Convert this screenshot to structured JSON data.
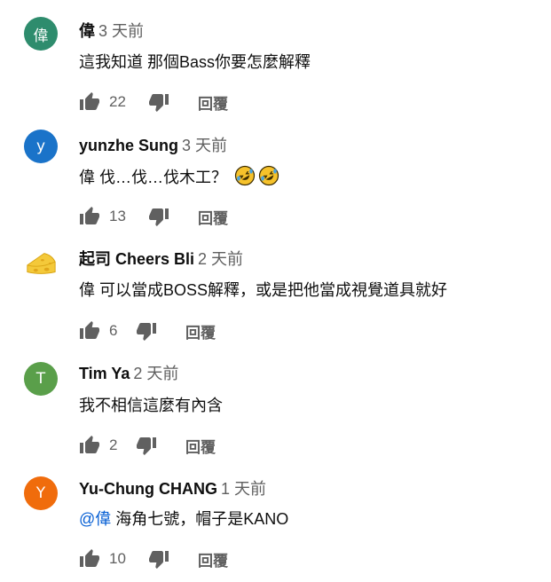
{
  "comments": [
    {
      "avatar_char": "偉",
      "avatar_color": "#2e8c6d",
      "author": "偉",
      "time": "3 天前",
      "text": "這我知道 那個Bass你要怎麼解釋",
      "likes": "22",
      "reply_label": "回覆"
    },
    {
      "avatar_char": "y",
      "avatar_color": "#1a73c9",
      "author": "yunzhe Sung",
      "time": "3 天前",
      "text": "偉 伐…伐…伐木工？",
      "emojis": [
        "rofl-emoji",
        "rofl-emoji"
      ],
      "likes": "13",
      "reply_label": "回覆"
    },
    {
      "avatar_char": "",
      "avatar_icon": "cheese-icon",
      "author": "起司 Cheers Bli",
      "time": "2 天前",
      "text": "偉 可以當成BOSS解釋，或是把他當成視覺道具就好",
      "likes": "6",
      "reply_label": "回覆"
    },
    {
      "avatar_char": "T",
      "avatar_color": "#5a9f4a",
      "author": "Tim Ya",
      "time": "2 天前",
      "text": "我不相信這麼有內含",
      "likes": "2",
      "reply_label": "回覆"
    },
    {
      "avatar_char": "Y",
      "avatar_color": "#f06c0c",
      "author": "Yu-Chung CHANG",
      "time": "1 天前",
      "mention": "@偉",
      "text": "海角七號，帽子是KANO",
      "likes": "10",
      "reply_label": "回覆"
    }
  ]
}
